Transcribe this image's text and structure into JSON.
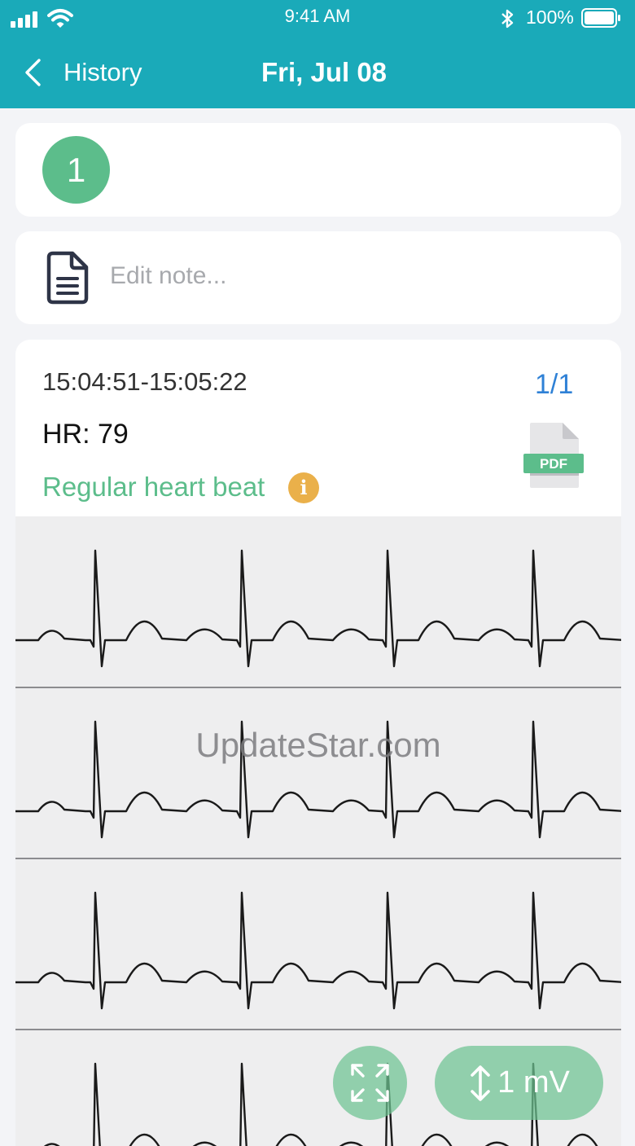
{
  "status_bar": {
    "time": "9:41 AM",
    "battery": "100%",
    "icons": [
      "signal-icon",
      "wifi-icon",
      "bluetooth-icon",
      "battery-icon"
    ]
  },
  "nav": {
    "back_label": "History",
    "title": "Fri, Jul 08"
  },
  "session": {
    "number": "1"
  },
  "note": {
    "placeholder": "Edit note..."
  },
  "record": {
    "time_range": "15:04:51-15:05:22",
    "page": "1/1",
    "hr": "HR: 79",
    "rhythm": "Regular heart beat",
    "info_icon": "i",
    "pdf_label": "PDF"
  },
  "ecg": {
    "strips": 4,
    "beats_per_strip": 4
  },
  "watermark": "UpdateStar.com",
  "controls": {
    "scale_label": "1 mV",
    "expand_icon": "expand-icon"
  },
  "colors": {
    "header": "#1aaab9",
    "accent_green": "#5cbd8b",
    "link_blue": "#2f81d6",
    "info_orange": "#eab04a"
  }
}
